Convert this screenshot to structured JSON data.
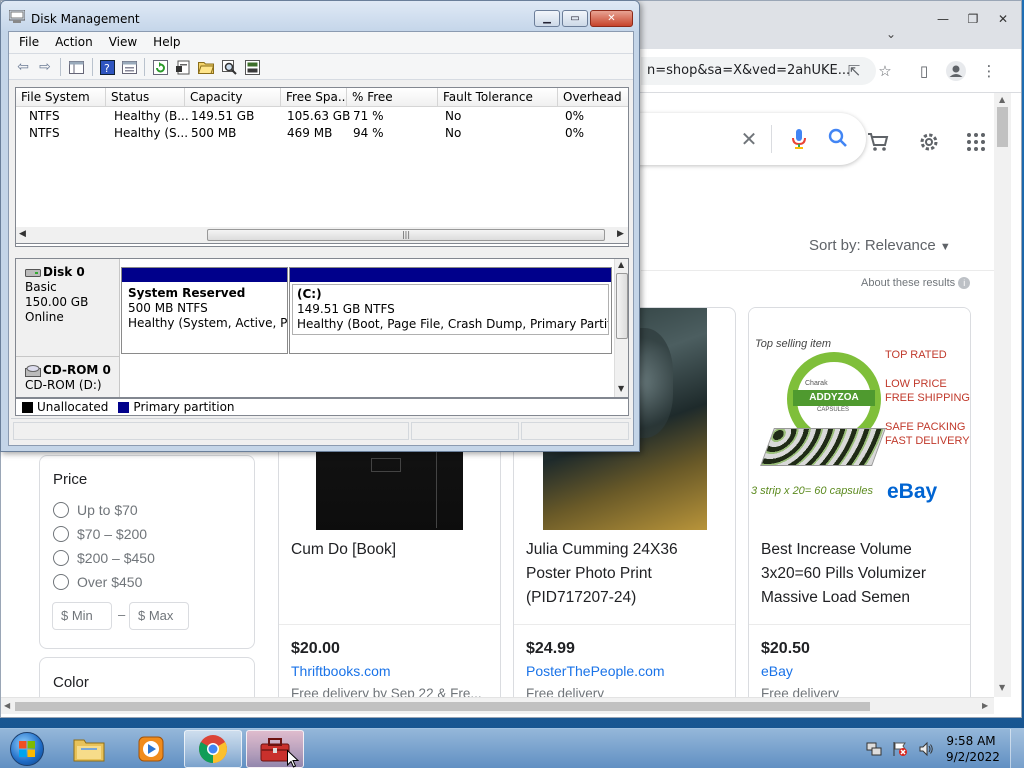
{
  "disk_mgmt": {
    "title": "Disk Management",
    "menu": [
      "File",
      "Action",
      "View",
      "Help"
    ],
    "columns": [
      "File System",
      "Status",
      "Capacity",
      "Free Spa...",
      "% Free",
      "Fault Tolerance",
      "Overhead"
    ],
    "rows": [
      [
        "NTFS",
        "Healthy (B...",
        "149.51 GB",
        "105.63 GB",
        "71 %",
        "No",
        "0%"
      ],
      [
        "NTFS",
        "Healthy (S...",
        "500 MB",
        "469 MB",
        "94 %",
        "No",
        "0%"
      ]
    ],
    "disks": [
      {
        "name": "Disk 0",
        "type": "Basic",
        "size": "150.00 GB",
        "status": "Online",
        "partitions": [
          {
            "name": "System Reserved",
            "size": "500 MB NTFS",
            "status": "Healthy (System, Active, Prin"
          },
          {
            "name": "(C:)",
            "size": "149.51 GB NTFS",
            "status": "Healthy (Boot, Page File, Crash Dump, Primary Partition)"
          }
        ]
      },
      {
        "name": "CD-ROM 0",
        "type": "CD-ROM (D:)"
      }
    ],
    "legend": [
      {
        "label": "Unallocated",
        "color": "#000000"
      },
      {
        "label": "Primary partition",
        "color": "#00008b"
      }
    ]
  },
  "chrome": {
    "url_fragment": "n=shop&sa=X&ved=2ahUKE...",
    "sort_label": "Sort by: Relevance",
    "about_label": "About these results",
    "price_filter": {
      "title": "Price",
      "options": [
        "Up to $70",
        "$70 – $200",
        "$200 – $450",
        "Over $450"
      ],
      "min_placeholder": "$ Min",
      "dash": "–",
      "max_placeholder": "$ Max"
    },
    "color_filter": {
      "title": "Color"
    },
    "products": [
      {
        "title": "Cum Do [Book]",
        "price": "$20.00",
        "seller": "Thriftbooks.com",
        "delivery": "Free delivery by Sep 22 & Fre..."
      },
      {
        "title": "Julia Cumming 24X36 Poster Photo Print (PID717207-24)",
        "price": "$24.99",
        "seller": "PosterThePeople.com",
        "delivery": "Free delivery"
      },
      {
        "title": "Best Increase Volume 3x20=60 Pills Volumizer Massive Load Semen",
        "price": "$20.50",
        "seller": "eBay",
        "delivery": "Free delivery"
      }
    ],
    "ad_image": {
      "top_text": "Top selling item",
      "right_text": [
        "TOP RATED",
        "LOW PRICE",
        "FREE SHIPPING",
        "SAFE PACKING",
        "FAST DELIVERY"
      ],
      "brand": "Charak",
      "product": "ADDYZOA",
      "sub": "CAPSULES",
      "bottom_text": "3 strip x 20= 60 capsules",
      "logo": "eBay"
    }
  },
  "taskbar": {
    "time": "9:58 AM",
    "date": "9/2/2022"
  },
  "colors": {
    "partition_bar": "#00008b",
    "google_blue": "#1a73e8",
    "desktop": "#1e6fb5"
  }
}
